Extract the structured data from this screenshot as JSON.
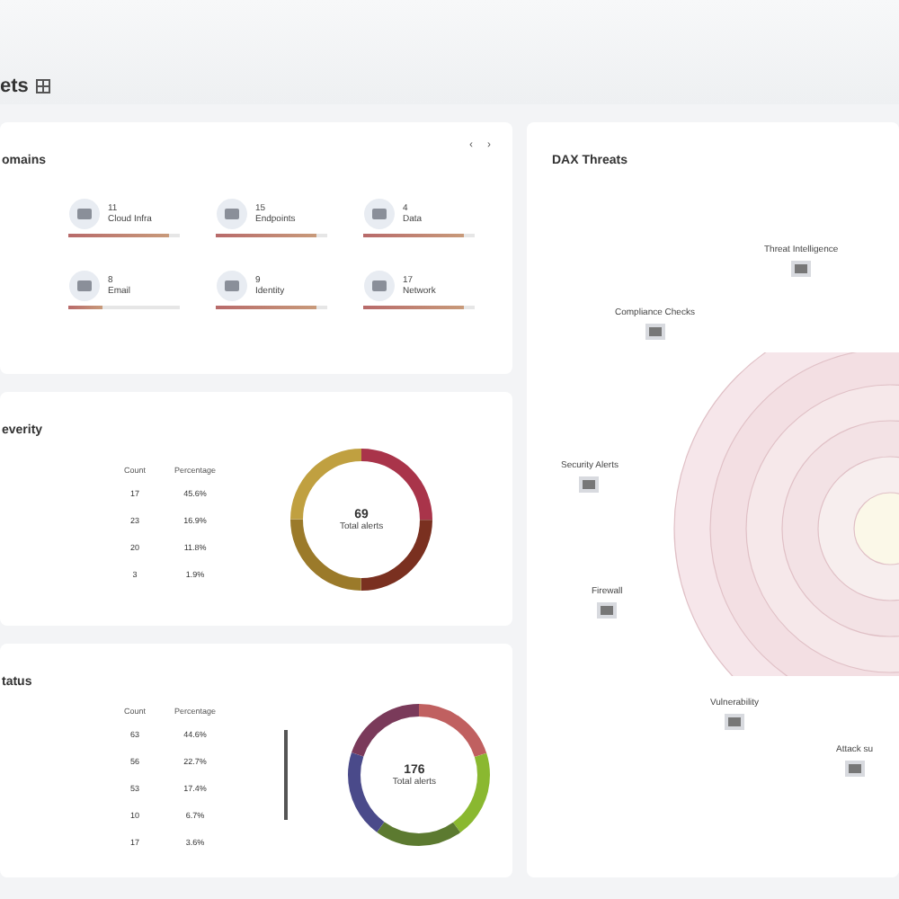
{
  "header": {
    "title": "ets"
  },
  "domains": {
    "title": "omains",
    "nav": [
      "‹",
      "›"
    ],
    "items": [
      {
        "count": "11",
        "label": "Cloud Infra",
        "level": 0.9
      },
      {
        "count": "15",
        "label": "Endpoints",
        "level": 0.9
      },
      {
        "count": "4",
        "label": "Data",
        "level": 0.9
      },
      {
        "count": "8",
        "label": "Email",
        "level": 0.3
      },
      {
        "count": "9",
        "label": "Identity",
        "level": 0.9
      },
      {
        "count": "17",
        "label": "Network",
        "level": 0.9
      }
    ]
  },
  "severity": {
    "title": "everity",
    "columns": [
      "Count",
      "Percentage"
    ],
    "rows": [
      [
        "17",
        "45.6%"
      ],
      [
        "23",
        "16.9%"
      ],
      [
        "20",
        "11.8%"
      ],
      [
        "3",
        "1.9%"
      ]
    ],
    "total": "69",
    "total_label": "Total alerts"
  },
  "status": {
    "title": "tatus",
    "columns": [
      "Count",
      "Percentage"
    ],
    "rows": [
      [
        "63",
        "44.6%"
      ],
      [
        "56",
        "22.7%"
      ],
      [
        "53",
        "17.4%"
      ],
      [
        "10",
        "6.7%"
      ],
      [
        "17",
        "3.6%"
      ]
    ],
    "total": "176",
    "total_label": "Total alerts"
  },
  "threats": {
    "title": "DAX Threats",
    "nodes": [
      {
        "label": "Threat Intelligence"
      },
      {
        "label": "Compliance Checks"
      },
      {
        "label": "Security Alerts"
      },
      {
        "label": "Firewall"
      },
      {
        "label": "Vulnerability"
      },
      {
        "label": "Attack su"
      }
    ]
  }
}
